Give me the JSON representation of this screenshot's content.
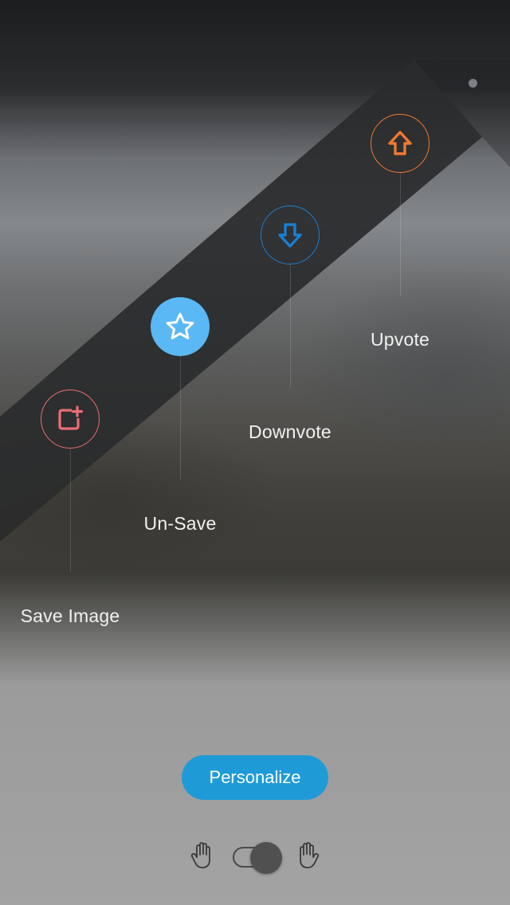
{
  "actions": [
    {
      "id": "save-image",
      "label": "Save Image",
      "icon": "add-image-icon",
      "color": "#e86f74",
      "filled": false
    },
    {
      "id": "un-save",
      "label": "Un-Save",
      "icon": "star-icon",
      "color": "#5ab8f5",
      "filled": true
    },
    {
      "id": "downvote",
      "label": "Downvote",
      "icon": "arrow-down-icon",
      "color": "#1a7fd0",
      "filled": false
    },
    {
      "id": "upvote",
      "label": "Upvote",
      "icon": "arrow-up-icon",
      "color": "#ee7a30",
      "filled": false
    }
  ],
  "personalize": {
    "label": "Personalize",
    "color": "#1e9bd7"
  },
  "handedness": {
    "left_icon": "left-hand-icon",
    "right_icon": "right-hand-icon",
    "toggle_state": "right"
  }
}
